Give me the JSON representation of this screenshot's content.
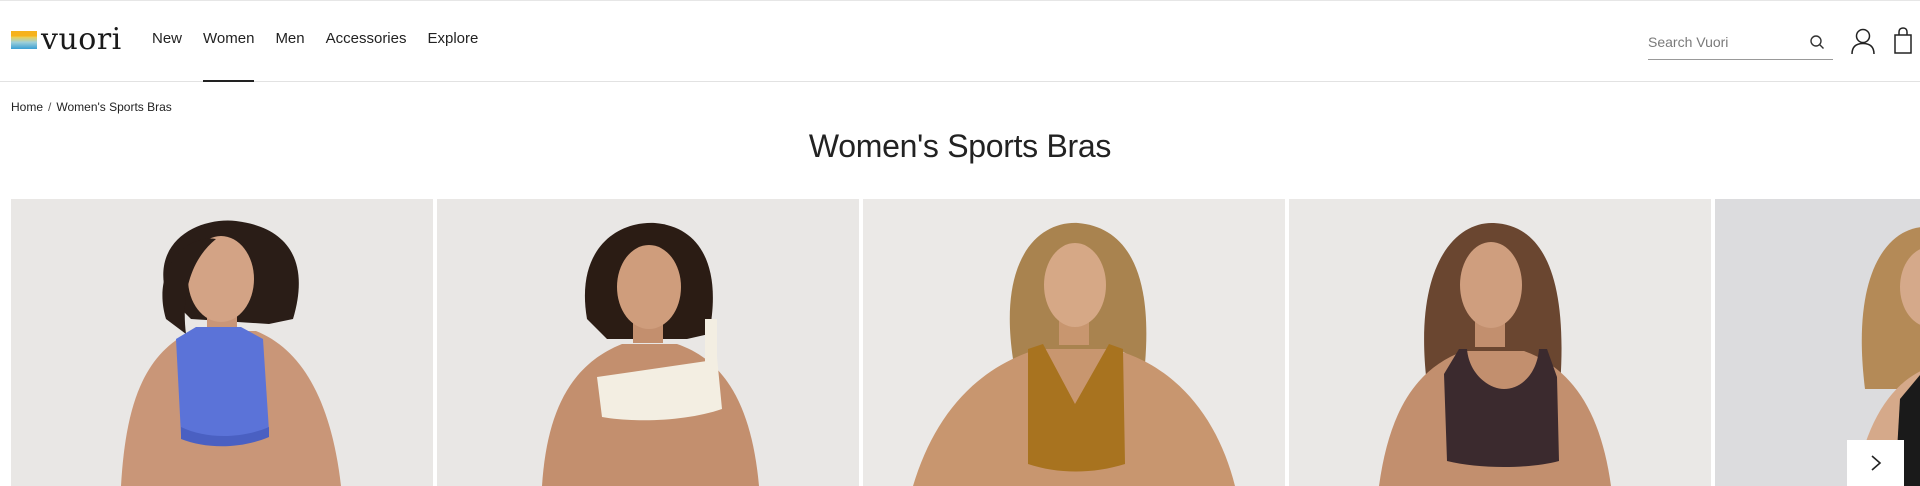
{
  "brand": {
    "name": "vuori"
  },
  "nav": {
    "items": [
      "New",
      "Women",
      "Men",
      "Accessories",
      "Explore"
    ],
    "active": "Women"
  },
  "search": {
    "placeholder": "Search Vuori"
  },
  "breadcrumb": {
    "home": "Home",
    "separator": "/",
    "current": "Women's Sports Bras"
  },
  "page": {
    "title": "Women's Sports Bras"
  },
  "products": [
    {
      "image": "model-blue-high-neck-sports-bra",
      "color": "#5b73d8"
    },
    {
      "image": "model-cream-asymmetric-sports-bra",
      "color": "#f3eee2"
    },
    {
      "image": "model-caramel-v-neck-sports-bra",
      "color": "#a8731f"
    },
    {
      "image": "model-plum-scoop-sports-bra",
      "color": "#3b2a2e"
    },
    {
      "image": "model-black-sports-bra",
      "color": "#1a1a1a"
    }
  ],
  "colors": {
    "accent": "#222222",
    "background": "#ffffff",
    "photo_bg": "#e9e7e5"
  }
}
